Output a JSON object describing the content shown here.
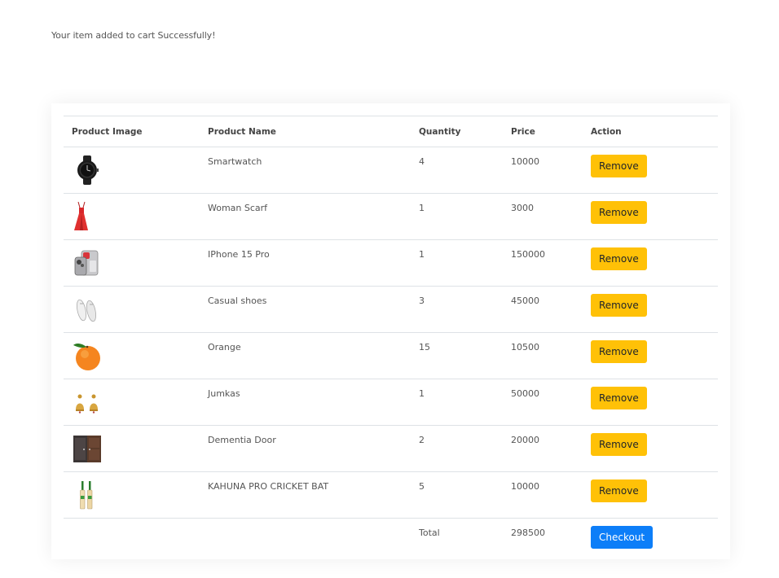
{
  "message": "Your item added to cart Successfully!",
  "table": {
    "headers": [
      "Product Image",
      "Product Name",
      "Quantity",
      "Price",
      "Action"
    ],
    "rows": [
      {
        "name": "Smartwatch",
        "quantity": "4",
        "price": "10000",
        "action": "Remove",
        "icon": "smartwatch-image"
      },
      {
        "name": "Woman Scarf",
        "quantity": "1",
        "price": "3000",
        "action": "Remove",
        "icon": "dress-image"
      },
      {
        "name": "IPhone 15 Pro",
        "quantity": "1",
        "price": "150000",
        "action": "Remove",
        "icon": "phone-image"
      },
      {
        "name": "Casual shoes",
        "quantity": "3",
        "price": "45000",
        "action": "Remove",
        "icon": "shoes-image"
      },
      {
        "name": "Orange",
        "quantity": "15",
        "price": "10500",
        "action": "Remove",
        "icon": "orange-image"
      },
      {
        "name": "Jumkas",
        "quantity": "1",
        "price": "50000",
        "action": "Remove",
        "icon": "earrings-image"
      },
      {
        "name": "Dementia Door",
        "quantity": "2",
        "price": "20000",
        "action": "Remove",
        "icon": "door-image"
      },
      {
        "name": "KAHUNA PRO CRICKET BAT",
        "quantity": "5",
        "price": "10000",
        "action": "Remove",
        "icon": "cricket-bat-image"
      }
    ],
    "total_label": "Total",
    "total_value": "298500",
    "checkout_label": "Checkout"
  },
  "colors": {
    "remove_button": "#ffc107",
    "checkout_button": "#0d7ef8",
    "border": "#dee2e6"
  }
}
